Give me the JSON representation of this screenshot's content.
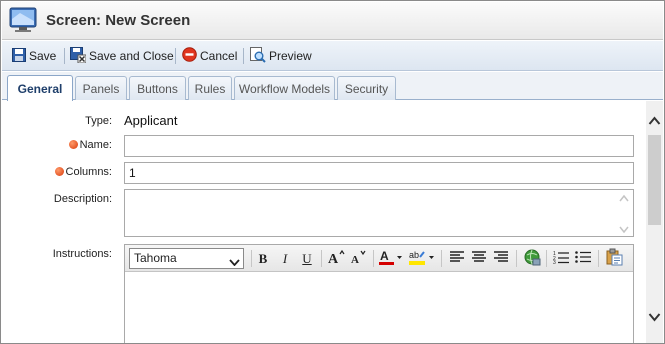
{
  "window": {
    "title": "Screen: New Screen"
  },
  "toolbar": {
    "save_label": "Save",
    "save_close_label": "Save and Close",
    "cancel_label": "Cancel",
    "preview_label": "Preview"
  },
  "tabs": [
    {
      "label": "General",
      "active": true
    },
    {
      "label": "Panels",
      "active": false
    },
    {
      "label": "Buttons",
      "active": false
    },
    {
      "label": "Rules",
      "active": false
    },
    {
      "label": "Workflow Models",
      "active": false
    },
    {
      "label": "Security",
      "active": false
    }
  ],
  "form": {
    "type_label": "Type:",
    "type_value": "Applicant",
    "name_label": "Name:",
    "name_value": "",
    "columns_label": "Columns:",
    "columns_value": "1",
    "description_label": "Description:",
    "description_value": "",
    "instructions_label": "Instructions:"
  },
  "editor": {
    "font": "Tahoma",
    "bold_glyph": "B",
    "italic_glyph": "I",
    "underline_glyph": "U",
    "font_color": "#d40000",
    "highlight_color": "#ffe600"
  }
}
